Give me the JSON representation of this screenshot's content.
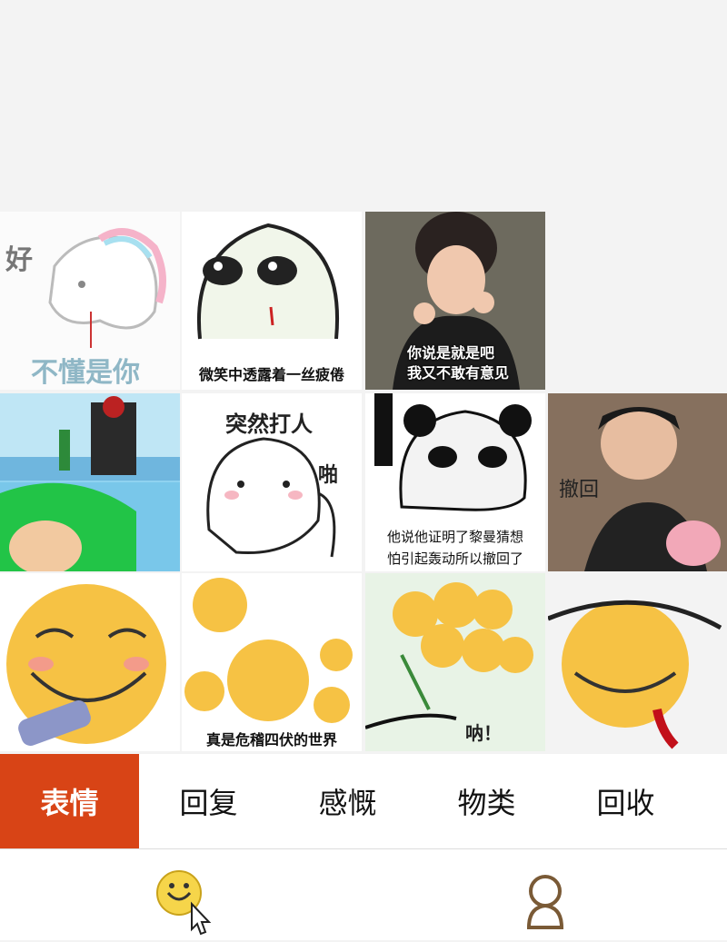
{
  "grid": {
    "r0c0_text": "好",
    "r0c0_text2": "不懂是你",
    "r0c1_caption": "微笑中透露着一丝疲倦",
    "r0c2_caption_line1": "你说是就是吧",
    "r0c2_caption_line2": "我又不敢有意见",
    "r1c1_title": "突然打人",
    "r1c1_side": "啪",
    "r1c2_caption_line1": "他说他证明了黎曼猜想",
    "r1c2_caption_line2": "怕引起轰动所以撤回了",
    "r1c3_caption": "撤回",
    "r2c1_caption": "真是危稽四伏的世界",
    "r2c2_caption": "呐！"
  },
  "tabs": {
    "items": [
      {
        "label": "表情"
      },
      {
        "label": "回复"
      },
      {
        "label": "感慨"
      },
      {
        "label": "物类"
      },
      {
        "label": "回收"
      }
    ]
  },
  "colors": {
    "accent": "#d84416",
    "emoji_yellow": "#f6c244"
  },
  "nav": {
    "left_icon": "emoji-icon",
    "right_icon": "profile-icon"
  }
}
